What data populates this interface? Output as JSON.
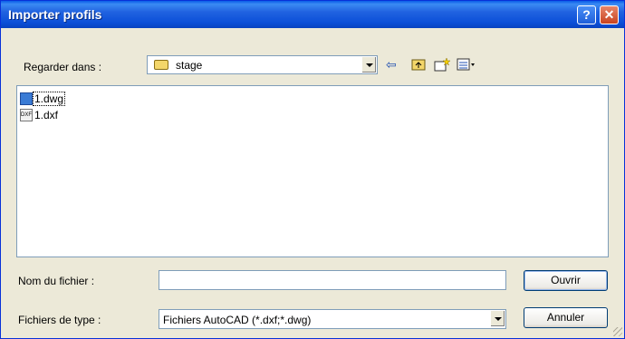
{
  "window": {
    "title": "Importer profils",
    "help_symbol": "?",
    "close_symbol": "✕"
  },
  "look_in": {
    "label": "Regarder dans :",
    "value": "stage"
  },
  "toolbar": {
    "back_icon": "back-arrow-icon",
    "up_icon": "up-one-level-icon",
    "new_folder_icon": "new-folder-icon",
    "view_menu_icon": "view-menu-icon"
  },
  "files": [
    {
      "name": "1.dwg",
      "icon_text": "",
      "selected": true
    },
    {
      "name": "1.dxf",
      "icon_text": "DXF",
      "selected": false
    }
  ],
  "filename": {
    "label": "Nom du fichier :",
    "value": ""
  },
  "filetype": {
    "label": "Fichiers de type :",
    "value": "Fichiers AutoCAD (*.dxf;*.dwg)"
  },
  "buttons": {
    "open": "Ouvrir",
    "cancel": "Annuler"
  },
  "colors": {
    "titlebar": "#0a5ce8",
    "dialog_bg": "#ece9d8",
    "border": "#7f9db9"
  }
}
